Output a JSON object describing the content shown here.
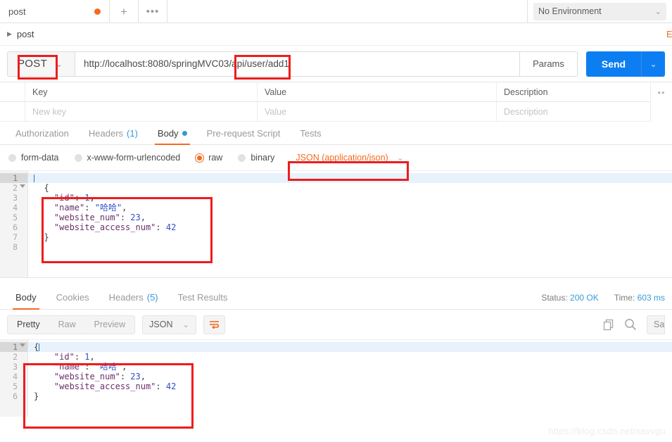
{
  "tabstrip": {
    "request_tab_label": "post",
    "new_tab_icon": "plus-icon",
    "more_icon": "ellipsis-icon",
    "environment_selected": "No Environment",
    "environment_caret": "chevron-down-icon"
  },
  "breadcrumb": {
    "arrow": "triangle-right-icon",
    "name": "post",
    "examples_link": "E"
  },
  "urlbar": {
    "method": "POST",
    "method_caret": "chevron-down-icon",
    "url": "http://localhost:8080/springMVC03/api/user/add1",
    "params_label": "Params",
    "send_label": "Send",
    "send_caret": "chevron-down-icon"
  },
  "params_table": {
    "headers": {
      "key": "Key",
      "value": "Value",
      "description": "Description",
      "bulk_icon": "ellipsis-icon"
    },
    "placeholder_row": {
      "key": "New key",
      "value": "Value",
      "description": "Description"
    }
  },
  "request_tabs": [
    {
      "label": "Authorization",
      "count": "",
      "active": false,
      "dot": false
    },
    {
      "label": "Headers",
      "count": "(1)",
      "active": false,
      "dot": false
    },
    {
      "label": "Body",
      "count": "",
      "active": true,
      "dot": true
    },
    {
      "label": "Pre-request Script",
      "count": "",
      "active": false,
      "dot": false
    },
    {
      "label": "Tests",
      "count": "",
      "active": false,
      "dot": false
    }
  ],
  "body_types": [
    {
      "label": "form-data",
      "checked": false
    },
    {
      "label": "x-www-form-urlencoded",
      "checked": false
    },
    {
      "label": "raw",
      "checked": true
    },
    {
      "label": "binary",
      "checked": false
    }
  ],
  "content_type_select": {
    "label": "JSON (application/json)",
    "caret": "chevron-down-icon"
  },
  "request_body": {
    "line_numbers": [
      "1",
      "2",
      "3",
      "4",
      "5",
      "6",
      "7",
      "8"
    ],
    "fold_line_index": 1,
    "active_line_index": 0,
    "lines": [
      {
        "indent": 0,
        "parts": []
      },
      {
        "indent": 1,
        "parts": [
          {
            "t": "punct",
            "v": "{"
          }
        ]
      },
      {
        "indent": 2,
        "parts": [
          {
            "t": "key",
            "v": "\"id\""
          },
          {
            "t": "punct",
            "v": ": "
          },
          {
            "t": "num",
            "v": "1"
          },
          {
            "t": "punct",
            "v": ","
          }
        ]
      },
      {
        "indent": 2,
        "parts": [
          {
            "t": "key",
            "v": "\"name\""
          },
          {
            "t": "punct",
            "v": ": "
          },
          {
            "t": "str",
            "v": "\"哈哈\""
          },
          {
            "t": "punct",
            "v": ","
          }
        ]
      },
      {
        "indent": 2,
        "parts": [
          {
            "t": "key",
            "v": "\"website_num\""
          },
          {
            "t": "punct",
            "v": ": "
          },
          {
            "t": "num",
            "v": "23"
          },
          {
            "t": "punct",
            "v": ","
          }
        ]
      },
      {
        "indent": 2,
        "parts": [
          {
            "t": "key",
            "v": "\"website_access_num\""
          },
          {
            "t": "punct",
            "v": ": "
          },
          {
            "t": "num",
            "v": "42"
          }
        ]
      },
      {
        "indent": 1,
        "parts": [
          {
            "t": "punct",
            "v": "}"
          }
        ]
      },
      {
        "indent": 0,
        "parts": []
      }
    ]
  },
  "response_tabs": [
    {
      "label": "Body",
      "count": "",
      "active": true
    },
    {
      "label": "Cookies",
      "count": "",
      "active": false
    },
    {
      "label": "Headers",
      "count": "(5)",
      "active": false
    },
    {
      "label": "Test Results",
      "count": "",
      "active": false
    }
  ],
  "response_meta": {
    "status_label": "Status:",
    "status_value": "200 OK",
    "time_label": "Time:",
    "time_value": "603 ms"
  },
  "response_toolbar": {
    "view_modes": [
      {
        "label": "Pretty",
        "active": true
      },
      {
        "label": "Raw",
        "active": false
      },
      {
        "label": "Preview",
        "active": false
      }
    ],
    "format_select": {
      "label": "JSON",
      "caret": "chevron-down-icon"
    },
    "wrap_icon": "word-wrap-icon",
    "copy_icon": "copy-icon",
    "search_icon": "search-icon",
    "save_response_label": "Sa"
  },
  "response_body": {
    "line_numbers": [
      "1",
      "2",
      "3",
      "4",
      "5",
      "6"
    ],
    "fold_line_index": 0,
    "active_line_index": 0,
    "lines": [
      {
        "indent": 0,
        "parts": [
          {
            "t": "punct",
            "v": "{"
          }
        ],
        "cursor": true
      },
      {
        "indent": 2,
        "parts": [
          {
            "t": "key",
            "v": "\"id\""
          },
          {
            "t": "punct",
            "v": ": "
          },
          {
            "t": "num",
            "v": "1"
          },
          {
            "t": "punct",
            "v": ","
          }
        ]
      },
      {
        "indent": 2,
        "parts": [
          {
            "t": "key",
            "v": "\"name\""
          },
          {
            "t": "punct",
            "v": ": "
          },
          {
            "t": "str",
            "v": "\"哈哈\""
          },
          {
            "t": "punct",
            "v": ","
          }
        ]
      },
      {
        "indent": 2,
        "parts": [
          {
            "t": "key",
            "v": "\"website_num\""
          },
          {
            "t": "punct",
            "v": ": "
          },
          {
            "t": "num",
            "v": "23"
          },
          {
            "t": "punct",
            "v": ","
          }
        ]
      },
      {
        "indent": 2,
        "parts": [
          {
            "t": "key",
            "v": "\"website_access_num\""
          },
          {
            "t": "punct",
            "v": ": "
          },
          {
            "t": "num",
            "v": "42"
          }
        ]
      },
      {
        "indent": 0,
        "parts": [
          {
            "t": "punct",
            "v": "}"
          }
        ]
      }
    ]
  },
  "watermark": "https://blog.csdn.net/xavvgu",
  "colors": {
    "accent_orange": "#f26b21",
    "send_blue": "#0d7ef2",
    "link_blue": "#3b9bd8",
    "annotation_red": "#ee1c1c",
    "json_key": "#6b2f6b",
    "json_value": "#2f4ec9"
  }
}
